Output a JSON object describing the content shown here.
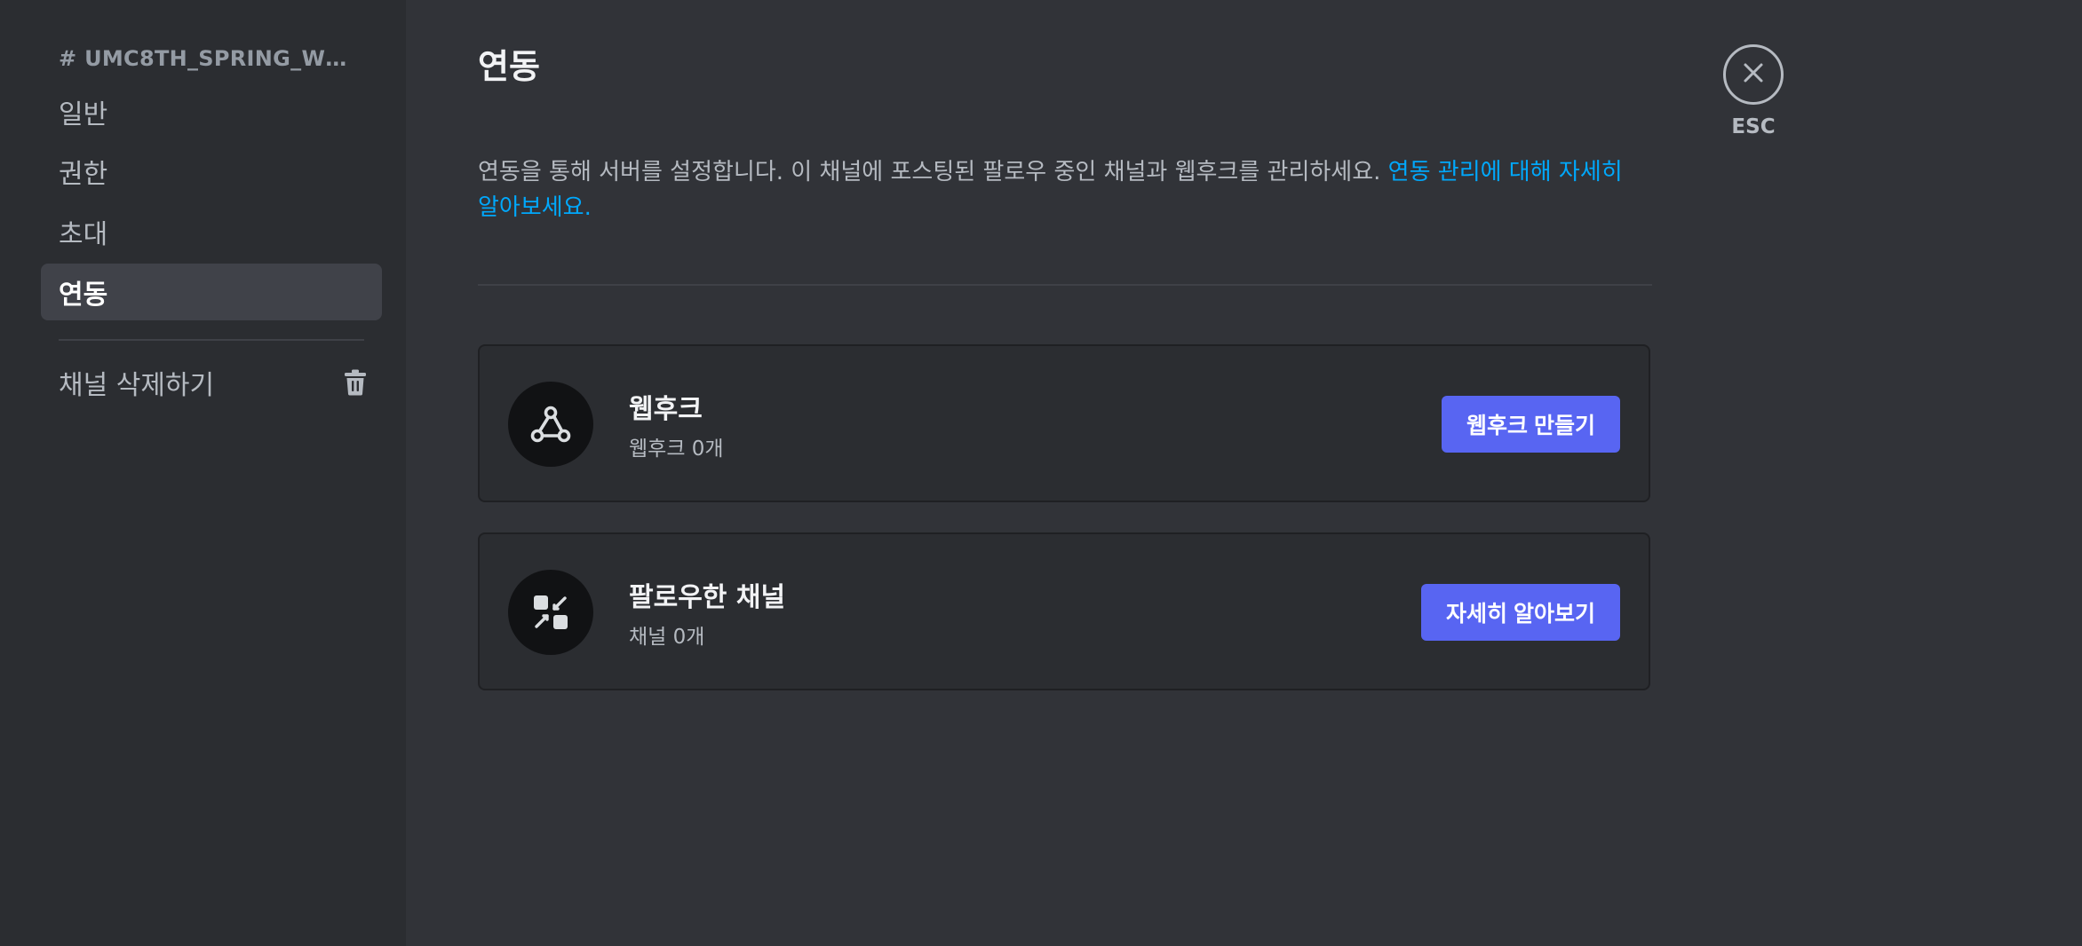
{
  "sidebar": {
    "channel_name": "# UMC8TH_SPRING_WEBH...",
    "items": [
      {
        "label": "일반"
      },
      {
        "label": "권한"
      },
      {
        "label": "초대"
      },
      {
        "label": "연동",
        "active": true
      }
    ],
    "delete_label": "채널 삭제하기",
    "delete_icon": "trash-icon"
  },
  "main": {
    "title": "연동",
    "description": "연동을 통해 서버를 설정합니다. 이 채널에 포스팅된 팔로우 중인 채널과 웹후크를 관리하세요. ",
    "description_link": "연동 관리에 대해 자세히 알아보세요.",
    "cards": [
      {
        "icon": "webhook-icon",
        "title": "웹후크",
        "subtitle": "웹후크 0개",
        "button": "웹후크 만들기"
      },
      {
        "icon": "followed-channel-icon",
        "title": "팔로우한 채널",
        "subtitle": "채널 0개",
        "button": "자세히 알아보기"
      }
    ]
  },
  "close": {
    "label": "ESC",
    "icon": "close-icon"
  },
  "colors": {
    "background": "#313338",
    "sidebar": "#2b2d31",
    "accent": "#5865f2",
    "link": "#00a8fc"
  }
}
